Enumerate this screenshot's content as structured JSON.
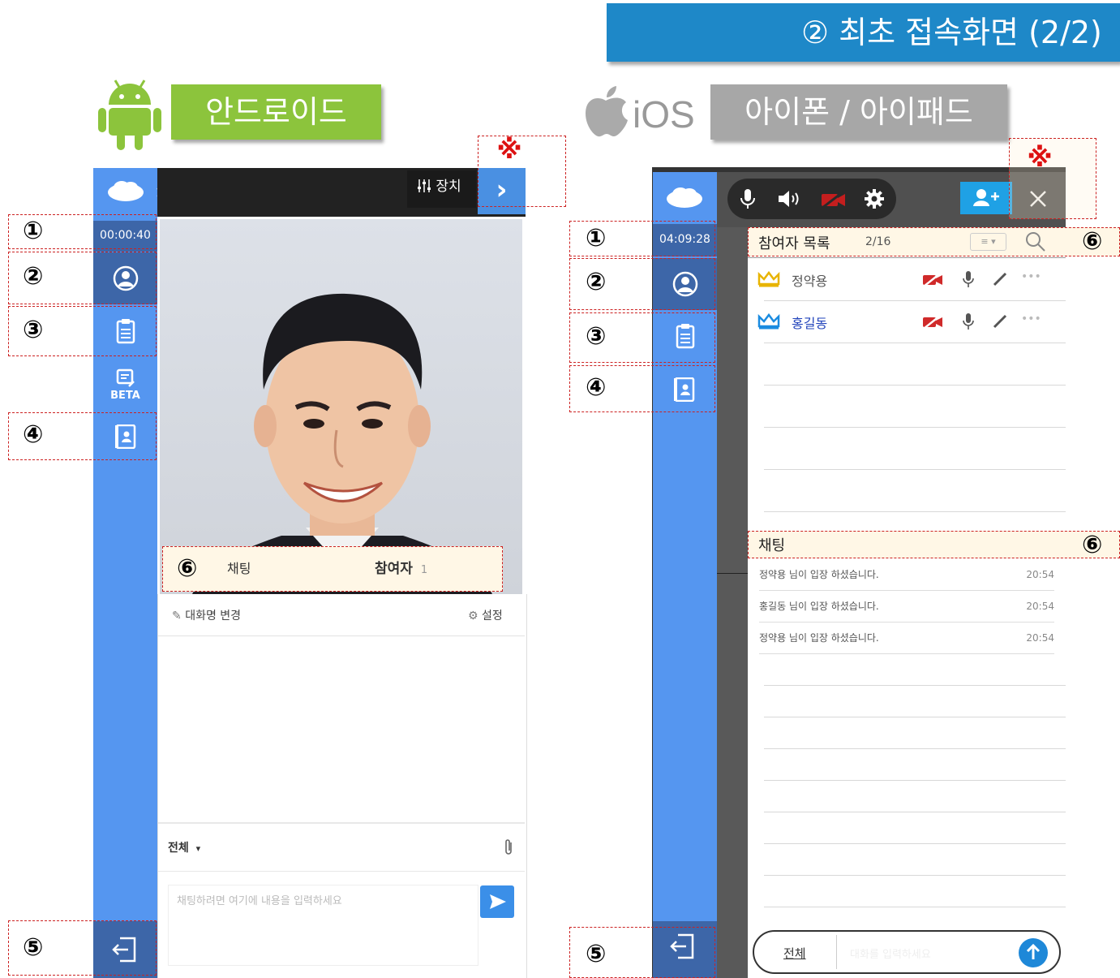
{
  "banner": {
    "title": "② 최초 접속화면 (2/2)"
  },
  "android": {
    "label": "안드로이드",
    "timer": "00:00:40",
    "beta": "BETA",
    "device_label": "장치",
    "chevron": "›",
    "room_num": "1",
    "tab_chat": "채팅",
    "tab_participants": "참여자",
    "participants_count": "1",
    "rename_label": "대화명 변경",
    "settings_label": "설정",
    "target_select": "전체",
    "target_caret": "▾",
    "input_placeholder": "채팅하려면 여기에 내용을 입력하세요"
  },
  "ios": {
    "logo_text": "iOS",
    "label": "아이폰 / 아이패드",
    "timer": "04:09:28",
    "list_title": "참여자 목록",
    "list_count": "2/16",
    "participants": [
      {
        "name": "정약용",
        "crown_color": "#e8b400",
        "name_color": "#555"
      },
      {
        "name": "홍길동",
        "crown_color": "#1a8be0",
        "name_color": "#2244bb"
      }
    ],
    "chat_title": "채팅",
    "messages": [
      {
        "text": "정약용 님이 입장 하셨습니다.",
        "time": "20:54"
      },
      {
        "text": "홍길동 님이 입장 하셨습니다.",
        "time": "20:54"
      },
      {
        "text": "정약용 님이 입장 하셨습니다.",
        "time": "20:54"
      }
    ],
    "target_select": "전체",
    "input_placeholder": "대화를 입력하세요"
  },
  "markers": {
    "m1": "①",
    "m2": "②",
    "m3": "③",
    "m4": "④",
    "m5": "⑤",
    "m6": "⑥",
    "note": "※"
  },
  "colors": {
    "sidebar": "#5596f0",
    "banner": "#1e88c8",
    "android_tag": "#8cc43c",
    "ios_tag": "#a7a7a7",
    "accent": "#3b8fe8"
  }
}
